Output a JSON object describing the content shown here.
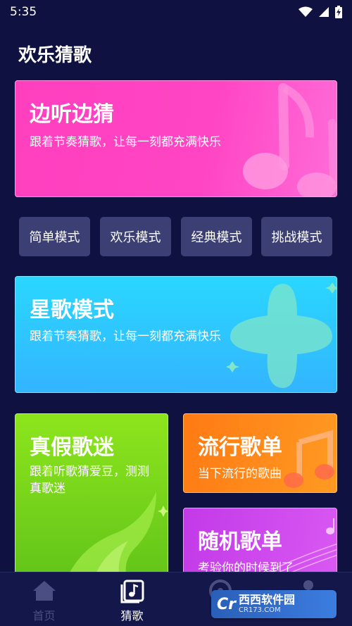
{
  "status": {
    "time": "5:35",
    "wifi_icon": "wifi-icon",
    "signal_icon": "signal-icon",
    "battery_icon": "battery-icon"
  },
  "page_title": "欢乐猜歌",
  "listen_card": {
    "title": "边听边猜",
    "subtitle": "跟着节奏猜歌，让每一刻都充满快乐",
    "color": "#ff45c4"
  },
  "modes": [
    {
      "label": "简单模式"
    },
    {
      "label": "欢乐模式"
    },
    {
      "label": "经典模式"
    },
    {
      "label": "挑战模式"
    }
  ],
  "star_card": {
    "title": "星歌模式",
    "subtitle": "跟着节奏猜歌，让每一刻都充满快乐",
    "color": "#33b4ff"
  },
  "fake_card": {
    "title": "真假歌迷",
    "subtitle": "跟着听歌猜爱豆，测测真歌迷",
    "color": "#7cd61c"
  },
  "pop_card": {
    "title": "流行歌单",
    "subtitle": "当下流行的歌曲",
    "color": "#ff8a1a"
  },
  "random_card": {
    "title": "随机歌单",
    "subtitle": "考验你的时候到了",
    "color": "#cc48ee"
  },
  "bottom_nav": [
    {
      "label": "首页",
      "icon": "home-icon",
      "active": false
    },
    {
      "label": "猜歌",
      "icon": "music-note-icon",
      "active": true
    },
    {
      "label": "",
      "icon": "disc-icon",
      "active": false
    },
    {
      "label": "",
      "icon": "person-icon",
      "active": false
    }
  ],
  "watermark": {
    "logo": "Cr",
    "name": "西西软件园",
    "url": "CR173.COM"
  }
}
